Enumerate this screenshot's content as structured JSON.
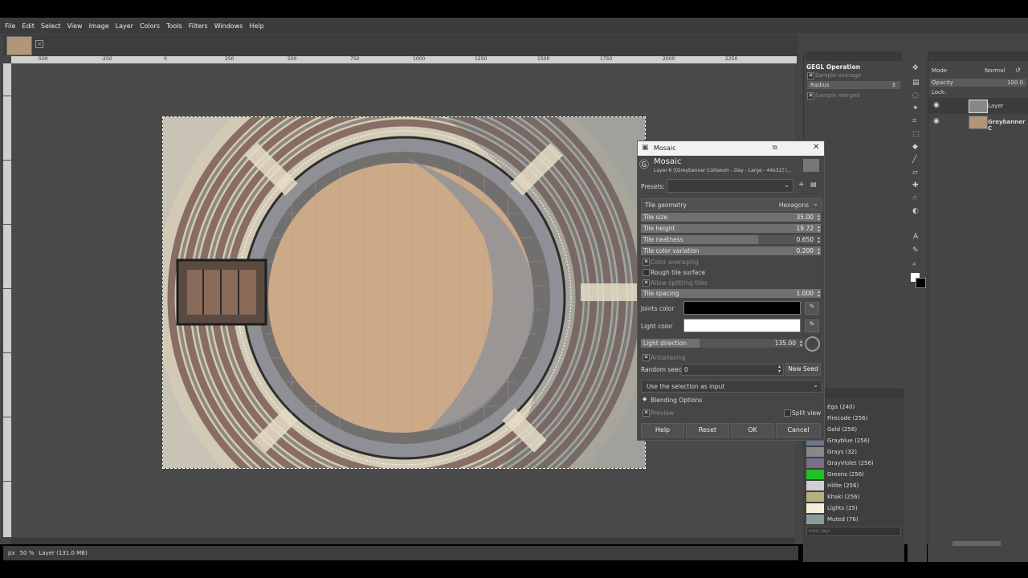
{
  "menu": [
    "File",
    "Edit",
    "Select",
    "View",
    "Image",
    "Layer",
    "Colors",
    "Tools",
    "Filters",
    "Windows",
    "Help"
  ],
  "ruler": {
    "ticks": [
      "-500",
      "-250",
      "0",
      "250",
      "500",
      "750",
      "1000",
      "1250",
      "1500",
      "1750",
      "2000",
      "2250"
    ]
  },
  "statusbar": {
    "unit": "px",
    "zoom": "50 %",
    "info": "Layer (131.0 MB)"
  },
  "gegl": {
    "title": "GEGL Operation",
    "sample_avg": "Sample average",
    "radius_label": "Radius",
    "radius_value": "3",
    "sample_merged": "Sample merged"
  },
  "dialog": {
    "window_title": "Mosaic",
    "heading": "Mosaic",
    "subheading": "Layer-6 ([Greybanner Coliseum - Day - Large - 44x32] (...",
    "presets_label": "Presets:",
    "geometry_label": "Tile geometry",
    "geometry_value": "Hexagons",
    "rows": [
      {
        "label": "Tile size",
        "value": "35.00",
        "fill": 1.0
      },
      {
        "label": "Tile height",
        "value": "19.72",
        "fill": 1.0
      },
      {
        "label": "Tile neatness",
        "value": "0.650",
        "fill": 0.65
      },
      {
        "label": "Tile color variation",
        "value": "0.200",
        "fill": 1.0
      }
    ],
    "color_averaging": "Color averaging",
    "rough_surface": "Rough tile surface",
    "allow_splitting": "Allow splitting tiles",
    "spacing_label": "Tile spacing",
    "spacing_value": "1.000",
    "joints_label": "Joints color",
    "joints_color": "#000000",
    "light_label": "Light color",
    "light_color": "#ffffff",
    "direction_label": "Light direction",
    "direction_value": "135.00",
    "antialiasing": "Antialiasing",
    "seed_label": "Random seed",
    "seed_value": "0",
    "new_seed": "New Seed",
    "selection_input": "Use the selection as input",
    "blending": "Blending Options",
    "preview": "Preview",
    "split_view": "Split view",
    "buttons": {
      "help": "Help",
      "reset": "Reset",
      "ok": "OK",
      "cancel": "Cancel"
    }
  },
  "layers_panel": {
    "mode_label": "Mode",
    "mode_value": "Normal",
    "opacity_label": "Opacity",
    "opacity_value": "100.0",
    "lock_label": "Lock:",
    "layers": [
      "Layer",
      "Greybanner C"
    ]
  },
  "palettes": [
    {
      "name": "Ega (240)",
      "color": "#5555ff"
    },
    {
      "name": "Firecode (256)",
      "color": "#cc3300"
    },
    {
      "name": "Gold (256)",
      "color": "#c9a227"
    },
    {
      "name": "Grayblue (256)",
      "color": "#6a7a8c"
    },
    {
      "name": "Grays (32)",
      "color": "#888888"
    },
    {
      "name": "GrayViolet (256)",
      "color": "#7a6f88"
    },
    {
      "name": "Greens (256)",
      "color": "#1fbf2a"
    },
    {
      "name": "Hilite (256)",
      "color": "#d0d0d0"
    },
    {
      "name": "Khaki (256)",
      "color": "#b8ae82"
    },
    {
      "name": "Lights (25)",
      "color": "#f4f0d8"
    },
    {
      "name": "Muted (76)",
      "color": "#8c9a9a"
    }
  ],
  "palette_filter_placeholder": "enter tags"
}
